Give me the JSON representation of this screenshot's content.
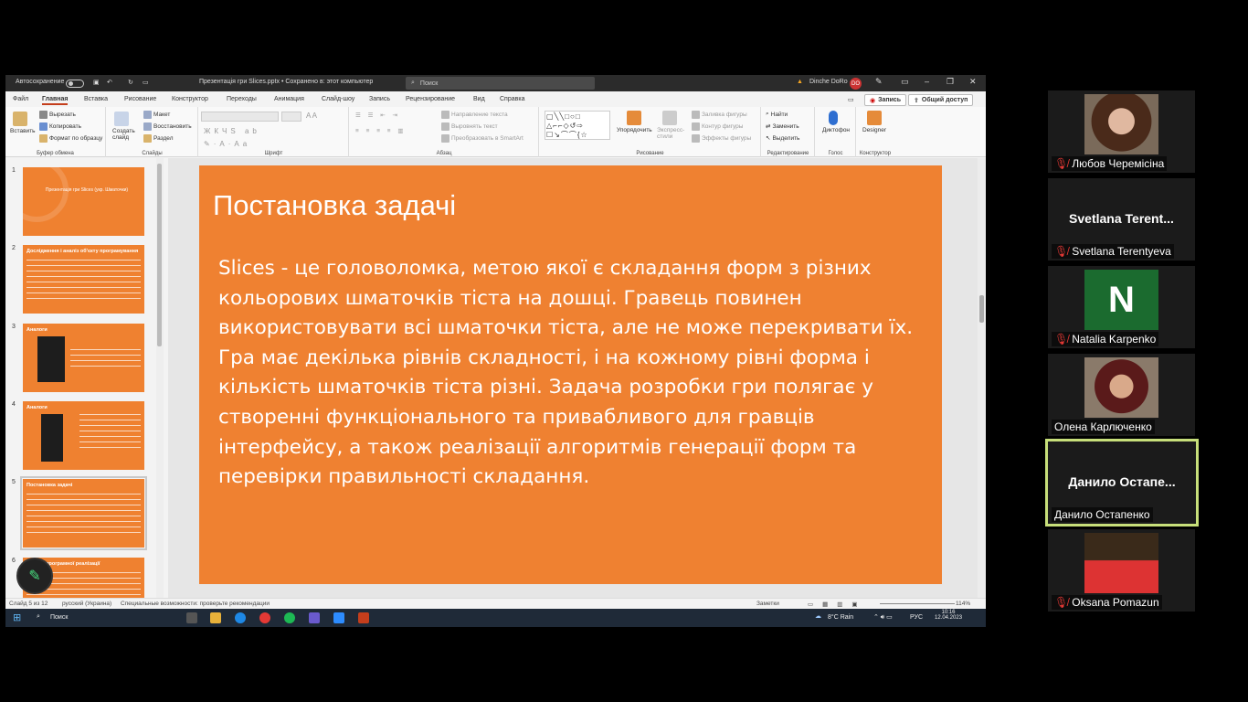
{
  "app": {
    "autosave_label": "Автосохранение",
    "doc_title": "Презентація гри Slices.pptx  •  Сохранено в: этот компьютер",
    "search_placeholder": "Поиск",
    "user_name": "Dinche DoRo",
    "user_initials": "DO"
  },
  "tabs": [
    "Файл",
    "Главная",
    "Вставка",
    "Рисование",
    "Конструктор",
    "Переходы",
    "Анимация",
    "Слайд-шоу",
    "Запись",
    "Рецензирование",
    "Вид",
    "Справка"
  ],
  "active_tab": "Главная",
  "record_button": "Запись",
  "share_button": "Общий доступ",
  "ribbon": {
    "clipboard": {
      "paste": "Вставить",
      "cut": "Вырезать",
      "copy": "Копировать",
      "format": "Формат по образцу",
      "label": "Буфер обмена"
    },
    "slides": {
      "create": "Создать слайд",
      "layout": "Макет",
      "reset": "Восстановить",
      "section": "Раздел",
      "label": "Слайды"
    },
    "font": {
      "label": "Шрифт"
    },
    "paragraph": {
      "direction": "Направление текста",
      "align": "Выровнять текст",
      "smartart": "Преобразовать в SmartArt",
      "label": "Абзац"
    },
    "drawing": {
      "arrange": "Упорядочить",
      "quick_styles": "Экспресс-стили",
      "fill": "Заливка фигуры",
      "outline": "Контур фигуры",
      "effects": "Эффекты фигуры",
      "label": "Рисование"
    },
    "editing": {
      "find": "Найти",
      "replace": "Заменить",
      "select": "Выделить",
      "label": "Редактирование"
    },
    "voice": {
      "dictate": "Диктофон",
      "label": "Голос"
    },
    "designer": {
      "designer": "Designer",
      "label": "Конструктор"
    }
  },
  "thumbnails": [
    {
      "num": "1",
      "title": "Презентація гри Slices (укр. Шматочки)"
    },
    {
      "num": "2",
      "title": "Дослідження і аналіз об'єкту програмування"
    },
    {
      "num": "3",
      "title": "Аналоги"
    },
    {
      "num": "4",
      "title": "Аналоги"
    },
    {
      "num": "5",
      "title": "Постановка задачі"
    },
    {
      "num": "6",
      "title": "Засоби програмної реалізації"
    }
  ],
  "slide": {
    "title": "Постановка задачі",
    "body": "Slices - це головоломка, метою якої є складання форм з різних кольорових шматочків тіста на дошці. Гравець повинен використовувати всі шматочки тіста, але не може перекривати їх. Гра має декілька рівнів складності, і на кожному рівні форма і кількість шматочків тіста різні. Задача розробки гри полягає у створенні функціонального та привабливого для гравців інтерфейсу, а також реалізації алгоритмів генерації форм та перевірки правильності складання."
  },
  "status": {
    "slide_count": "Слайд 5 из 12",
    "language": "русский (Украина)",
    "accessibility": "Специальные возможности: проверьте рекомендации",
    "notes": "Заметки",
    "zoom": "114%"
  },
  "taskbar": {
    "search": "Поиск",
    "weather": "8°C  Rain",
    "lang": "РУС",
    "time": "10:16",
    "date": "12.04.2023"
  },
  "participants": [
    {
      "name": "Любов Черемісіна",
      "muted": true,
      "type": "photo"
    },
    {
      "name": "Svetlana Terentyeva",
      "display": "Svetlana  Terent...",
      "muted": true,
      "type": "text"
    },
    {
      "name": "Natalia Karpenko",
      "initial": "N",
      "muted": true,
      "type": "initial"
    },
    {
      "name": "Олена Карлюченко",
      "muted": false,
      "type": "photo"
    },
    {
      "name": "Данило Остапенко",
      "display": "Данило  Остапе...",
      "muted": false,
      "type": "text",
      "speaking": true
    },
    {
      "name": "Oksana Pomazun",
      "muted": true,
      "type": "photo"
    }
  ],
  "colors": {
    "slide_bg": "#ef8131",
    "speaking_border": "#c7df7a",
    "ppt_accent": "#c43e1c"
  }
}
